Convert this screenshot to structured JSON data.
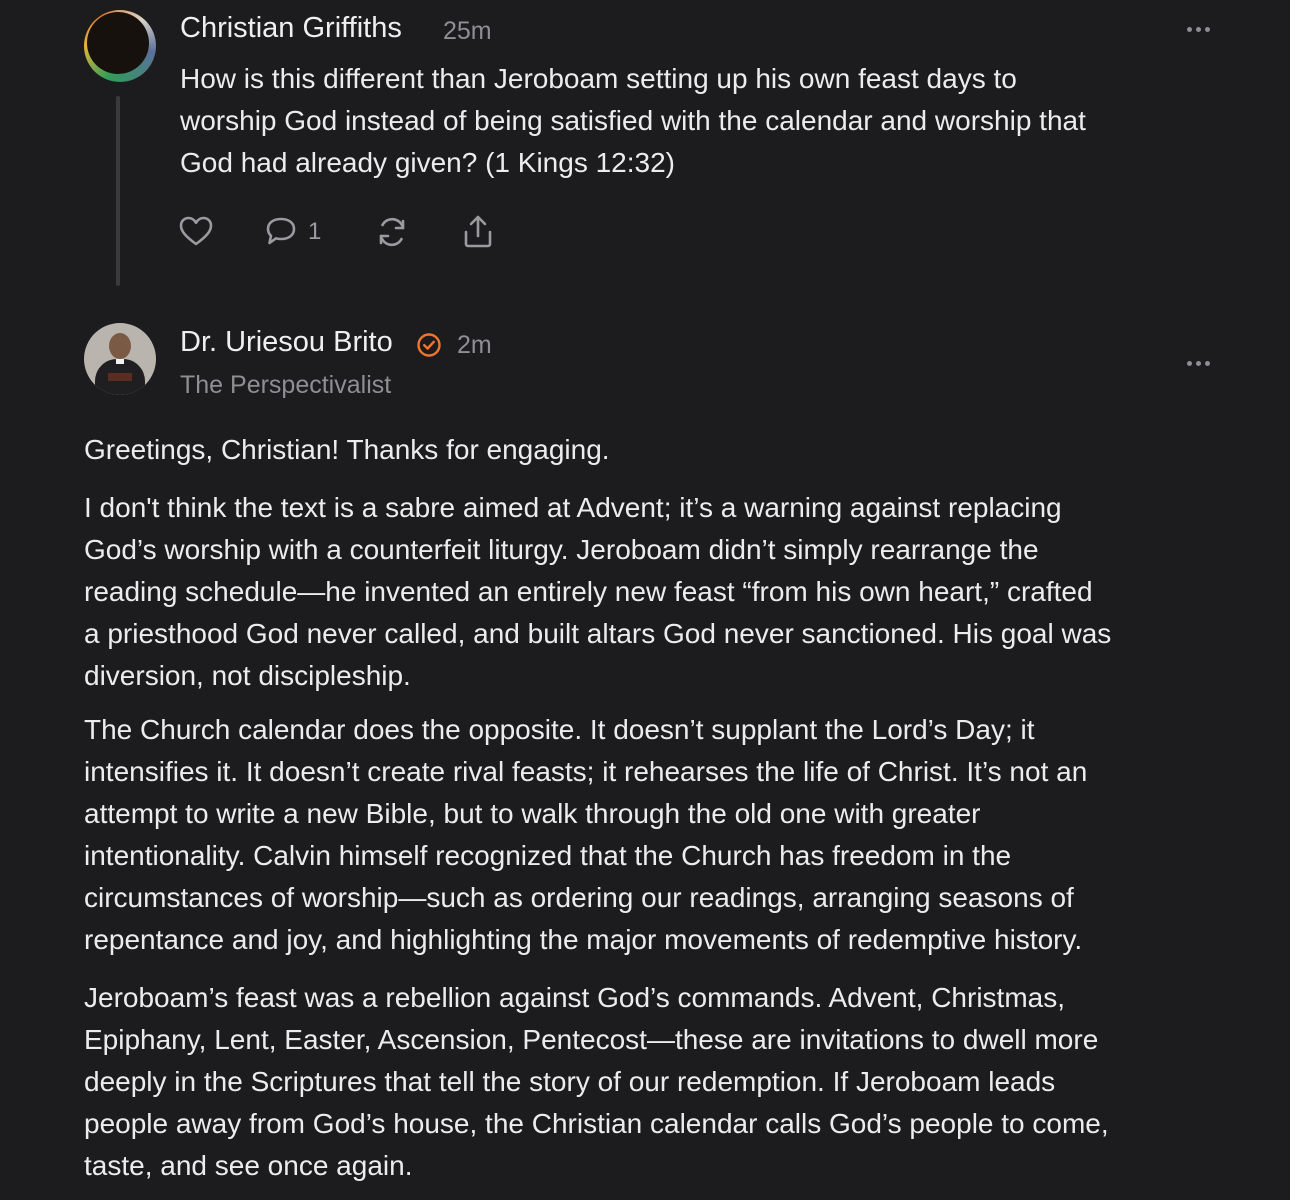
{
  "comment1": {
    "author": "Christian Griffiths",
    "time": "25m",
    "lines": [
      "How is this different than Jeroboam setting up his own feast days to",
      "worship God instead of being satisfied with the calendar and worship that",
      "God had already given? (1 Kings 12:32)"
    ],
    "actions": {
      "like_icon": "heart-icon",
      "reply_icon": "comment-bubble-icon",
      "reply_count": "1",
      "restack_icon": "restack-icon",
      "share_icon": "share-icon"
    },
    "avatar_colors": [
      "#2f9e58",
      "#e2b53a",
      "#e07b2e",
      "#d8d4c8",
      "#5a6f9a"
    ]
  },
  "comment2": {
    "author": "Dr. Uriesou Brito",
    "badge_icon": "verified-check-icon",
    "badge_color": "#f0762f",
    "time": "2m",
    "publication": "The Perspectivalist",
    "paragraphs": [
      {
        "lines": [
          "Greetings, Christian! Thanks for engaging."
        ]
      },
      {
        "lines": [
          "I don't think the text is a sabre aimed at Advent; it’s a warning against replacing",
          "God’s worship with a counterfeit liturgy. Jeroboam didn’t simply rearrange the",
          "reading schedule—he invented an entirely new feast “from his own heart,” crafted",
          "a priesthood God never called, and built altars God never sanctioned. His goal was",
          "diversion, not discipleship."
        ]
      },
      {
        "lines": [
          "The Church calendar does the opposite. It doesn’t supplant the Lord’s Day; it",
          "intensifies it. It doesn’t create rival feasts; it rehearses the life of Christ. It’s not an",
          "attempt to write a new Bible, but to walk through the old one with greater",
          "intentionality. Calvin himself recognized that the Church has freedom in the",
          "circumstances of worship—such as ordering our readings, arranging seasons of",
          "repentance and joy, and highlighting the major movements of redemptive history."
        ]
      },
      {
        "lines": [
          "Jeroboam’s feast was a rebellion against God’s commands. Advent, Christmas,",
          "Epiphany, Lent, Easter, Ascension, Pentecost—these are invitations to dwell more",
          "deeply in the Scriptures that tell the story of our redemption. If Jeroboam leads",
          "people away from God’s house, the Christian calendar calls God’s people to come,",
          "taste, and see once again."
        ]
      }
    ]
  },
  "ui": {
    "background": "#1c1c1e",
    "more_icon": "more-horizontal-icon"
  }
}
